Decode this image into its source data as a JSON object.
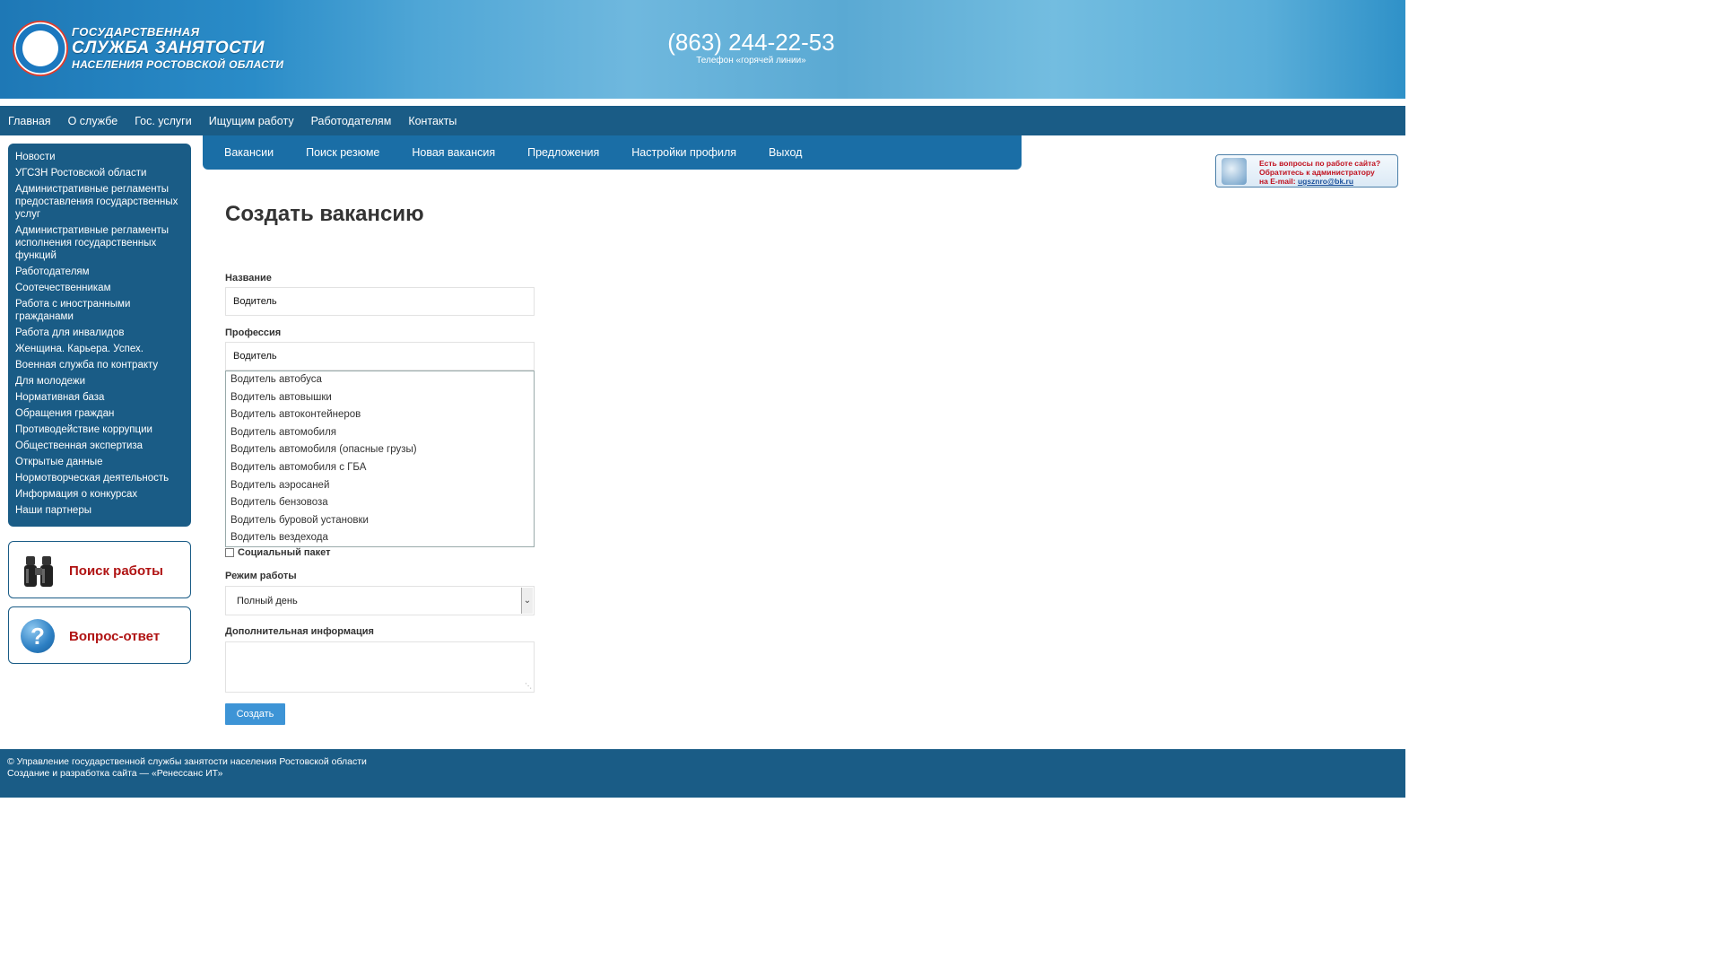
{
  "header": {
    "logo_line1": "ГОСУДАРСТВЕННАЯ",
    "logo_line2": "СЛУЖБА ЗАНЯТОСТИ",
    "logo_line3": "НАСЕЛЕНИЯ РОСТОВСКОЙ ОБЛАСТИ",
    "phone": "(863) 244-22-53",
    "phone_caption": "Телефон «горячей линии»"
  },
  "top_nav": [
    "Главная",
    "О службе",
    "Гос. услуги",
    "Ищущим работу",
    "Работодателям",
    "Контакты"
  ],
  "left_menu": [
    "Новости",
    "УГСЗН Ростовской области",
    "Административные регламенты предоставления государственных услуг",
    "Административные регламенты исполнения государственных функций",
    "Работодателям",
    "Соотечественникам",
    "Работа с иностранными гражданами",
    "Работа для инвалидов",
    "Женщина. Карьера. Успех.",
    "Военная служба по контракту",
    "Для молодежи",
    "Нормативная база",
    "Обращения граждан",
    "Противодействие коррупции",
    "Общественная экспертиза",
    "Открытые данные",
    "Нормотворческая деятельность",
    "Информация о конкурсах",
    "Наши партнеры"
  ],
  "promo": {
    "job_search": "Поиск работы",
    "qa": "Вопрос-ответ"
  },
  "sub_nav": [
    "Вакансии",
    "Поиск резюме",
    "Новая вакансия",
    "Предложения",
    "Настройки профиля",
    "Выход"
  ],
  "form": {
    "title": "Создать вакансию",
    "name_label": "Название",
    "name_value": "Водитель",
    "profession_label": "Профессия",
    "profession_value": "Водитель",
    "suggestions": [
      "Водитель автобуса",
      "Водитель автовышки",
      "Водитель автоконтейнеров",
      "Водитель автомобиля",
      "Водитель автомобиля (опасные грузы)",
      "Водитель автомобиля с ГБА",
      "Водитель аэросаней",
      "Водитель бензовоза",
      "Водитель буровой установки",
      "Водитель вездехода"
    ],
    "social_label": "Социальный пакет",
    "mode_label": "Режим работы",
    "mode_value": "Полный день",
    "extra_label": "Дополнительная информация",
    "submit": "Создать"
  },
  "banner": {
    "line1": "Есть вопросы по работе сайта?",
    "line2": "Обратитесь к администратору",
    "line3_prefix": "на E-mail:",
    "email": "ugsznro@bk.ru"
  },
  "footer": {
    "line1": "© Управление государственной службы занятости населения Ростовской области",
    "line2": "Создание и разработка сайта — «Ренессанс ИТ»"
  },
  "colors": {
    "nav_bg": "#1a5c86",
    "subnav_bg": "#1a6ea6",
    "button": "#3d94d6",
    "promo_text": "#b01313"
  }
}
